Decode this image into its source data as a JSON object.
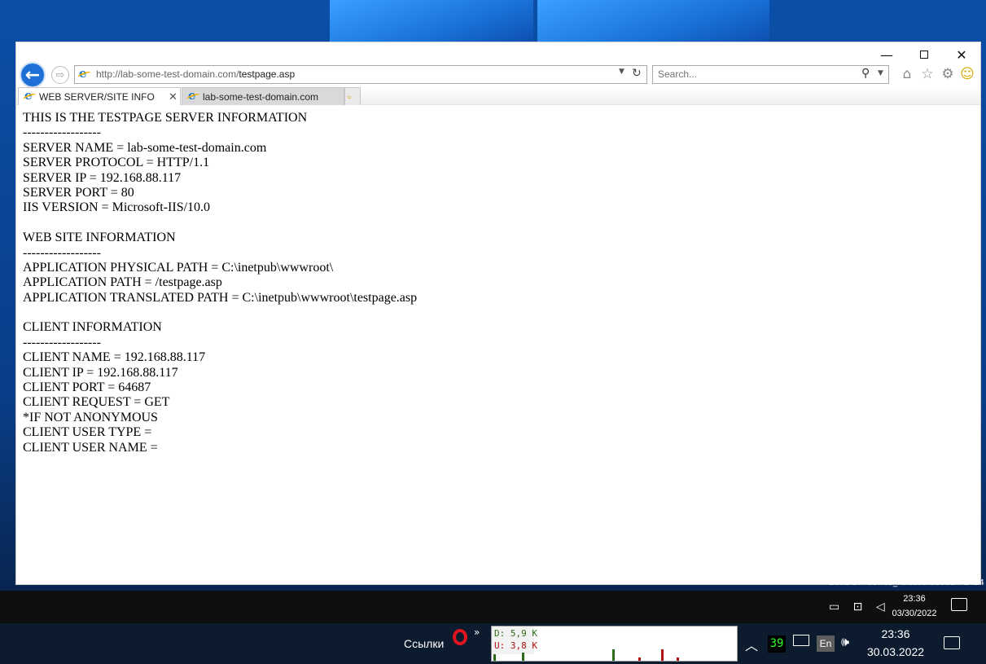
{
  "browser": {
    "address_prefix": "http://lab-some-test-domain.com/",
    "address_path": "testpage.asp",
    "search_placeholder": "Search...",
    "tabs": [
      {
        "label": "WEB SERVER/SITE INFO",
        "active": true
      },
      {
        "label": "lab-some-test-domain.com",
        "active": false
      }
    ],
    "window_buttons": {
      "minimize": "—",
      "maximize": "",
      "close": "✕"
    }
  },
  "page": {
    "lines": [
      "THIS IS THE TESTPAGE SERVER INFORMATION",
      "------------------",
      "SERVER NAME = lab-some-test-domain.com",
      "SERVER PROTOCOL = HTTP/1.1",
      "SERVER IP = 192.168.88.117",
      "SERVER PORT = 80",
      "IIS VERSION = Microsoft-IIS/10.0",
      "",
      "WEB SITE INFORMATION",
      "------------------",
      "APPLICATION PHYSICAL PATH = C:\\inetpub\\wwwroot\\",
      "APPLICATION PATH = /testpage.asp",
      "APPLICATION TRANSLATED PATH = C:\\inetpub\\wwwroot\\testpage.asp",
      "",
      "CLIENT INFORMATION",
      "------------------",
      "CLIENT NAME = 192.168.88.117",
      "CLIENT IP = 192.168.88.117",
      "CLIENT PORT = 64687",
      "CLIENT REQUEST = GET",
      "*IF NOT ANONYMOUS",
      "CLIENT USER TYPE =",
      "CLIENT USER NAME ="
    ]
  },
  "desktop": {
    "build_text": "Build 17763.rs5_release.180914-1434"
  },
  "notify_bar": {
    "time": "23:36",
    "date": "03/30/2022"
  },
  "taskbar": {
    "links_label": "Ссылки",
    "chevron": "»",
    "net_download": "D: 5,9 K",
    "net_upload": "U: 3,8 K",
    "cpu_value": "39",
    "language": "En",
    "time": "23:36",
    "date": "30.03.2022",
    "colors": {
      "download": "#2e6b19",
      "upload": "#b10f0f",
      "cpu": "#27ff27"
    }
  }
}
